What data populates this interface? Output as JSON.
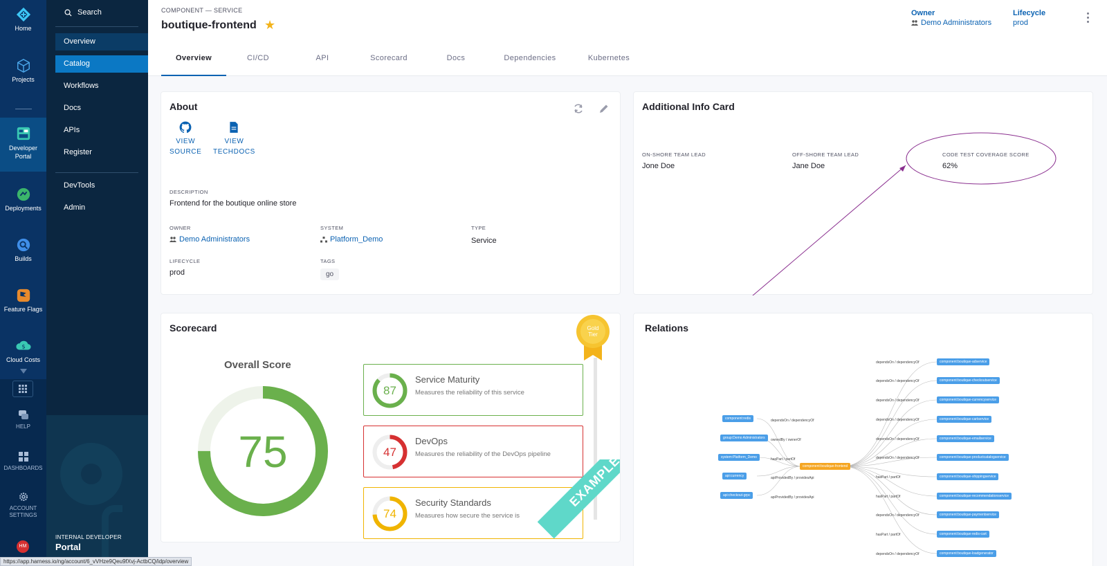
{
  "rail": {
    "home": "Home",
    "projects": "Projects",
    "developer_portal": "Developer Portal",
    "deployments": "Deployments",
    "builds": "Builds",
    "feature_flags": "Feature Flags",
    "cloud_costs": "Cloud Costs",
    "help": "HELP",
    "dashboards": "DASHBOARDS",
    "account_settings": "ACCOUNT SETTINGS",
    "avatar_initials": "HM"
  },
  "nav": {
    "search_label": "Search",
    "items": [
      "Overview",
      "Catalog",
      "Workflows",
      "Docs",
      "APIs",
      "Register",
      "DevTools",
      "Admin"
    ],
    "footer_kicker": "INTERNAL DEVELOPER",
    "footer_title": "Portal"
  },
  "header": {
    "kicker": "COMPONENT — SERVICE",
    "title": "boutique-frontend",
    "owner_label": "Owner",
    "owner_value": "Demo Administrators",
    "lifecycle_label": "Lifecycle",
    "lifecycle_value": "prod"
  },
  "tabs": [
    "Overview",
    "CI/CD",
    "API",
    "Scorecard",
    "Docs",
    "Dependencies",
    "Kubernetes"
  ],
  "about": {
    "title": "About",
    "view_source": [
      "VIEW",
      "SOURCE"
    ],
    "view_techdocs": [
      "VIEW",
      "TECHDOCS"
    ],
    "description_label": "DESCRIPTION",
    "description": "Frontend for the boutique online store",
    "owner_label": "OWNER",
    "owner": "Demo Administrators",
    "system_label": "SYSTEM",
    "system": "Platform_Demo",
    "type_label": "TYPE",
    "type": "Service",
    "lifecycle_label": "LIFECYCLE",
    "lifecycle": "prod",
    "tags_label": "TAGS",
    "tag": "go"
  },
  "additional": {
    "title": "Additional Info Card",
    "onshore_label": "ON-SHORE TEAM LEAD",
    "onshore": "Jone Doe",
    "offshore_label": "OFF-SHORE TEAM LEAD",
    "offshore": "Jane Doe",
    "coverage_label": "CODE TEST COVERAGE SCORE",
    "coverage": "62%"
  },
  "scorecard": {
    "title": "Scorecard",
    "overall_label": "Overall Score",
    "overall": 75,
    "badge": [
      "Gold",
      "Tier"
    ],
    "ribbon": "EXAMPLE",
    "checks": [
      {
        "name": "Service Maturity",
        "desc": "Measures the reliability of this service",
        "score": 87,
        "color": "#6ab04c"
      },
      {
        "name": "DevOps",
        "desc": "Measures the reliability of the DevOps pipeline",
        "score": 47,
        "color": "#d63031"
      },
      {
        "name": "Security Standards",
        "desc": "Measures how secure the service is",
        "score": 74,
        "color": "#f0b400"
      }
    ],
    "colors": {
      "overall": "#6ab04c",
      "track": "#eef3ea"
    }
  },
  "relations": {
    "title": "Relations",
    "center": "component:boutique-frontend",
    "left_nodes": [
      "component:redis",
      "group:Demo Administrators",
      "system:Platform_Demo",
      "api:currency",
      "api:checkout-grpc"
    ],
    "left_edge_labels": [
      "dependsOn / dependencyOf",
      "ownedBy / ownerOf",
      "hasPart / partOf",
      "apiProvidedBy / providesApi",
      "apiProvidedBy / providesApi"
    ],
    "right_nodes": [
      "component:boutique-adservice",
      "component:boutique-checkoutservice",
      "component:boutique-currencyservice",
      "component:boutique-cartservice",
      "component:boutique-emailservice",
      "component:boutique-productcatalogservice",
      "component:boutique-shippingservice",
      "component:boutique-recommendationservice",
      "component:boutique-paymentservice",
      "component:boutique-redis-cart",
      "component:boutique-loadgenerator"
    ],
    "right_edge_labels": [
      "dependsOn / dependencyOf",
      "dependsOn / dependencyOf",
      "dependsOn / dependencyOf",
      "dependsOn / dependencyOf",
      "dependsOn / dependencyOf",
      "dependsOn / dependencyOf",
      "hasPart / partOf",
      "hasPart / partOf",
      "dependsOn / dependencyOf",
      "hasPart / partOf",
      "dependsOn / dependencyOf"
    ]
  },
  "status_url": "https://app.harness.io/ng/account/6_vVHze9Qeu9fXvj-ActbCQ/idp/overview"
}
